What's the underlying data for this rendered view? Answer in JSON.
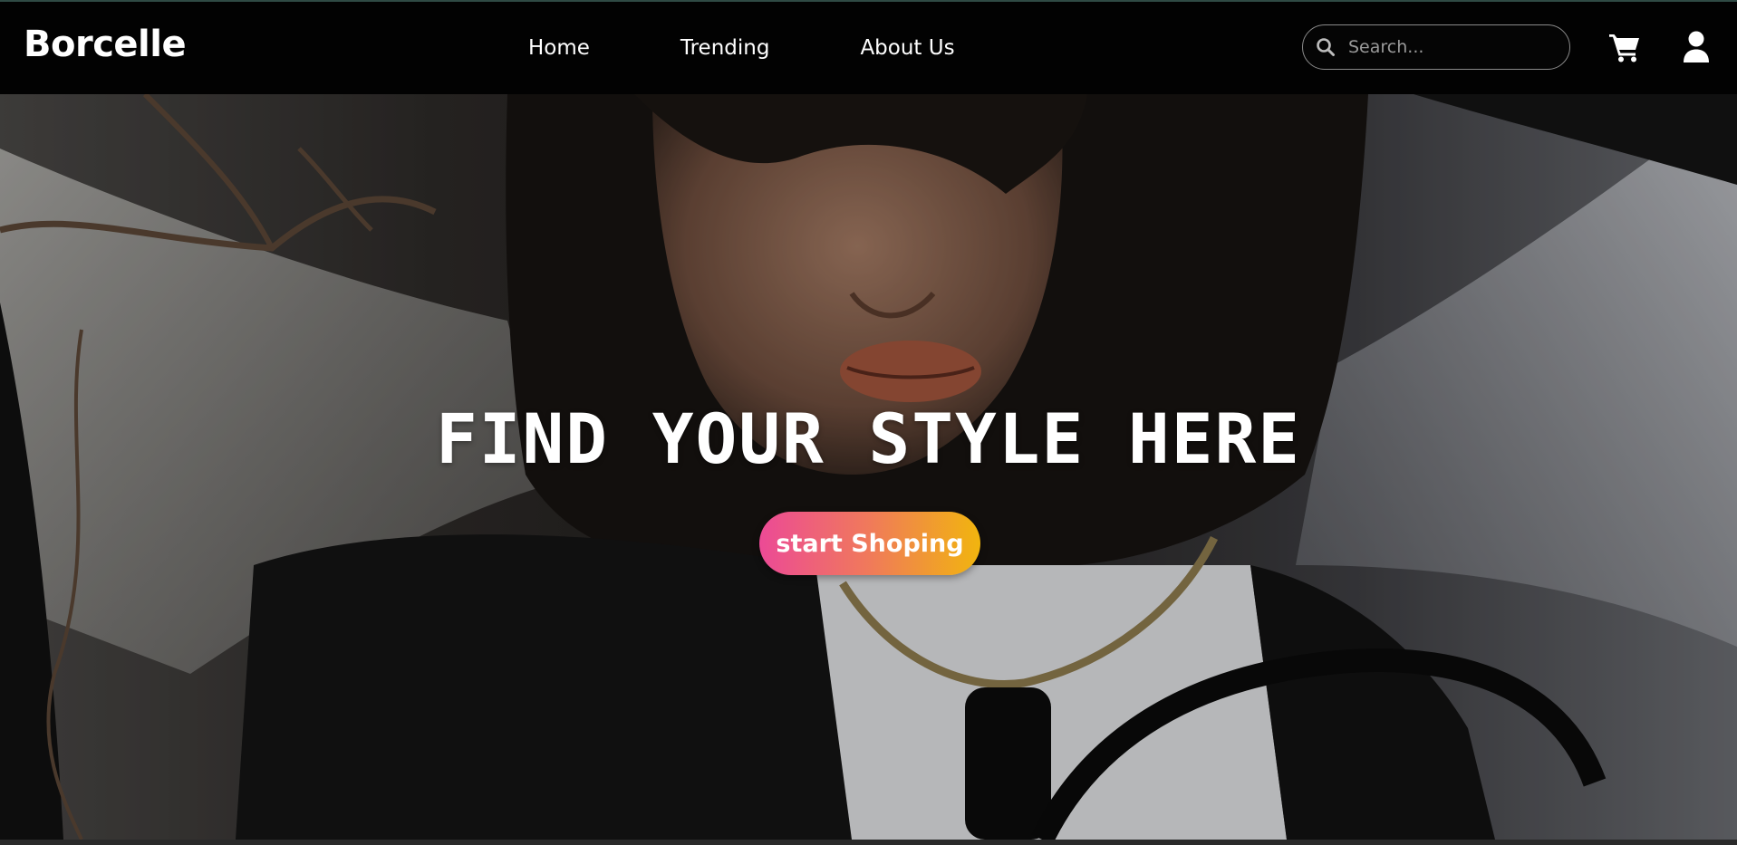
{
  "navbar": {
    "brand": "Borcelle",
    "links": [
      "Home",
      "Trending",
      "About Us"
    ],
    "search": {
      "placeholder": "Search...",
      "value": ""
    },
    "icons": {
      "search": "search-icon",
      "cart": "cart-icon",
      "user": "user-icon"
    }
  },
  "hero": {
    "title": "FIND YOUR STYLE HERE",
    "cta_label": "start Shoping"
  },
  "colors": {
    "nav_background": "#020202",
    "nav_text": "#ffffff",
    "cta_gradient_start": "#ec4a96",
    "cta_gradient_end": "#f1b50e"
  }
}
